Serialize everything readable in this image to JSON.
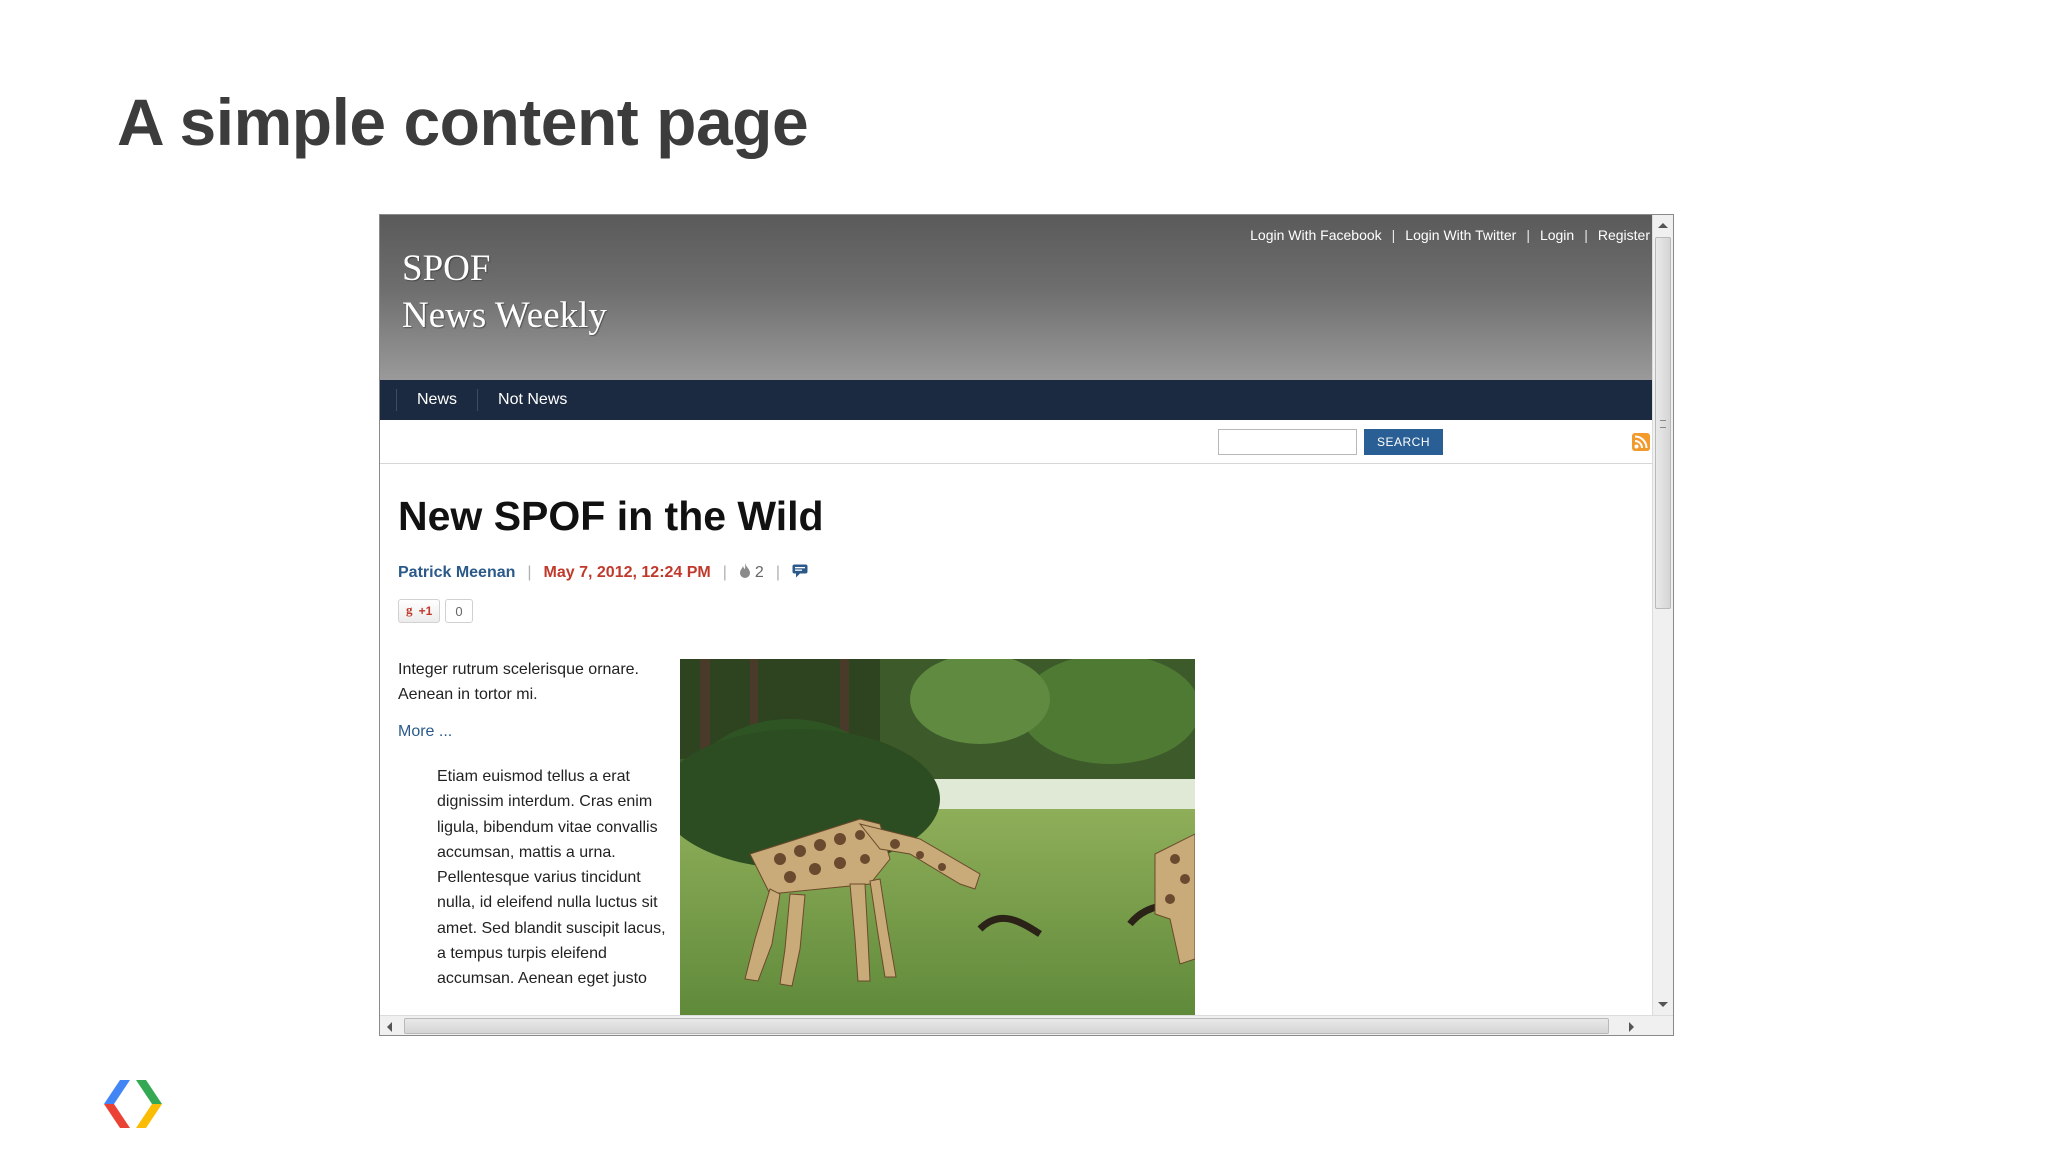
{
  "slide": {
    "title": "A simple content page"
  },
  "site": {
    "brand_line1": "SPOF",
    "brand_line2": "News Weekly",
    "top_links": [
      "Login With Facebook",
      "Login With Twitter",
      "Login",
      "Register"
    ],
    "link_separator": "|",
    "nav": [
      "News",
      "Not News"
    ],
    "search": {
      "value": "",
      "placeholder": "",
      "button_label": "SEARCH"
    }
  },
  "article": {
    "title": "New SPOF in the Wild",
    "author": "Patrick Meenan",
    "date": "May 7, 2012, 12:24 PM",
    "meta_separator": "|",
    "popularity_count": "2",
    "plusone_label": "+1",
    "plusone_count": "0",
    "intro": "Integer rutrum scelerisque ornare. Aenean in tortor mi.",
    "more_label": "More ...",
    "body": "Etiam euismod tellus a erat dignissim interdum. Cras enim ligula, bibendum vitae convallis accumsan, mattis a urna. Pellentesque varius tincidunt nulla, id eleifend nulla luctus sit amet. Sed blandit suscipit lacus, a tempus turpis eleifend accumsan. Aenean eget justo"
  },
  "colors": {
    "nav_background": "#1b2a40",
    "search_button": "#2a5f96",
    "author": "#2b5a8a",
    "date": "#c0392b",
    "rss": "#f39a2c"
  },
  "icons": [
    "flame-icon",
    "comment-icon",
    "rss-icon",
    "google-plus-icon",
    "google-developers-logo"
  ]
}
